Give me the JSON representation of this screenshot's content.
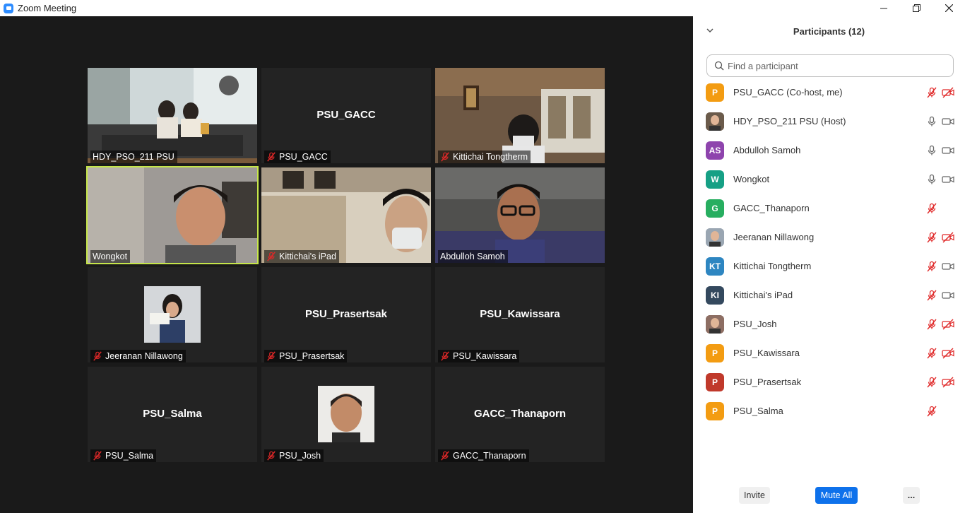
{
  "window": {
    "title": "Zoom Meeting",
    "controls": [
      "minimize",
      "restore",
      "close"
    ]
  },
  "video_grid": [
    {
      "name": "HDY_PSO_211 PSU",
      "display": "video",
      "scene": "office",
      "muted": false,
      "active": false
    },
    {
      "name": "PSU_GACC",
      "display": "name",
      "muted": true,
      "active": false
    },
    {
      "name": "Kittichai Tongtherm",
      "display": "video",
      "scene": "room-portrait",
      "muted": true,
      "active": false
    },
    {
      "name": "Wongkot",
      "display": "video",
      "scene": "man-closeup",
      "muted": false,
      "active": true
    },
    {
      "name": "Kittichai's iPad",
      "display": "video",
      "scene": "masked-man",
      "muted": true,
      "active": false
    },
    {
      "name": "Abdulloh Samoh",
      "display": "video",
      "scene": "glasses-man",
      "muted": false,
      "active": false
    },
    {
      "name": "Jeeranan Nillawong",
      "display": "photo",
      "photo": "woman-sign",
      "muted": true,
      "active": false
    },
    {
      "name": "PSU_Prasertsak",
      "display": "name",
      "muted": true,
      "active": false
    },
    {
      "name": "PSU_Kawissara",
      "display": "name",
      "muted": true,
      "active": false
    },
    {
      "name": "PSU_Salma",
      "display": "name",
      "muted": true,
      "active": false
    },
    {
      "name": "PSU_Josh",
      "display": "photo",
      "photo": "man-smiling",
      "muted": true,
      "active": false
    },
    {
      "name": "GACC_Thanaporn",
      "display": "name",
      "muted": true,
      "active": false
    }
  ],
  "participants_panel": {
    "title": "Participants (12)",
    "search_placeholder": "Find a participant",
    "participants": [
      {
        "name": "PSU_GACC (Co-host, me)",
        "avatar": "P",
        "avatar_color": "#f39c12",
        "mic": "muted",
        "video": "off"
      },
      {
        "name": "HDY_PSO_211 PSU (Host)",
        "avatar": "photo",
        "avatar_color": "#6b5b4b",
        "mic": "on",
        "video": "on"
      },
      {
        "name": "Abdulloh Samoh",
        "avatar": "AS",
        "avatar_color": "#8e44ad",
        "mic": "on",
        "video": "on"
      },
      {
        "name": "Wongkot",
        "avatar": "W",
        "avatar_color": "#16a085",
        "mic": "on",
        "video": "on"
      },
      {
        "name": "GACC_Thanaporn",
        "avatar": "G",
        "avatar_color": "#27ae60",
        "mic": "muted",
        "video": "none"
      },
      {
        "name": "Jeeranan Nillawong",
        "avatar": "photo",
        "avatar_color": "#9aa6b2",
        "mic": "muted",
        "video": "off"
      },
      {
        "name": "Kittichai Tongtherm",
        "avatar": "KT",
        "avatar_color": "#2e86c1",
        "mic": "muted",
        "video": "on"
      },
      {
        "name": "Kittichai's iPad",
        "avatar": "KI",
        "avatar_color": "#34495e",
        "mic": "muted",
        "video": "on"
      },
      {
        "name": "PSU_Josh",
        "avatar": "photo",
        "avatar_color": "#8d6e63",
        "mic": "muted",
        "video": "off"
      },
      {
        "name": "PSU_Kawissara",
        "avatar": "P",
        "avatar_color": "#f39c12",
        "mic": "muted",
        "video": "off"
      },
      {
        "name": "PSU_Prasertsak",
        "avatar": "P",
        "avatar_color": "#c0392b",
        "mic": "muted",
        "video": "off"
      },
      {
        "name": "PSU_Salma",
        "avatar": "P",
        "avatar_color": "#f39c12",
        "mic": "muted",
        "video": "none"
      }
    ],
    "buttons": {
      "invite": "Invite",
      "mute_all": "Mute All",
      "more": "..."
    }
  },
  "colors": {
    "accent": "#0e71eb",
    "active_speaker": "#c6e64a",
    "muted": "#e02828",
    "tile_bg": "#232323"
  }
}
